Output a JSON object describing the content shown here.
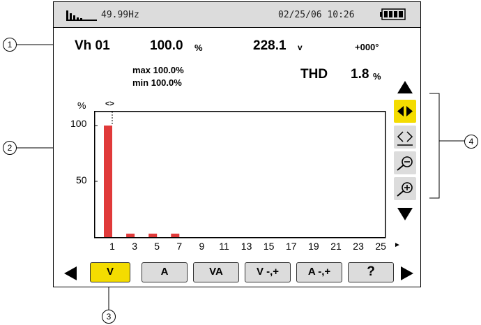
{
  "status": {
    "frequency": "49.99Hz",
    "datetime": "02/25/06 10:26"
  },
  "measure": {
    "harmonic_label": "Vh 01",
    "percent_value": "100.0",
    "percent_unit": "%",
    "volt_value": "228.1",
    "volt_unit": "v",
    "phase": "+000°",
    "max": "max 100.0%",
    "min": "min  100.0%",
    "thd_label": "THD",
    "thd_value": "1.8",
    "thd_unit": "%"
  },
  "chart_data": {
    "type": "bar",
    "ylabel": "%",
    "ytick_labels": [
      "100",
      "50"
    ],
    "cursor_marker": "<>",
    "categories": [
      "1",
      "2",
      "3",
      "4",
      "5",
      "6",
      "7",
      "8",
      "9",
      "10",
      "11",
      "12",
      "13",
      "14",
      "15",
      "16",
      "17",
      "18",
      "19",
      "20",
      "21",
      "22",
      "23",
      "24",
      "25"
    ],
    "values": [
      100,
      0,
      2,
      0,
      2,
      0,
      2,
      0,
      0,
      0,
      0,
      0,
      0,
      0,
      0,
      0,
      0,
      0,
      0,
      0,
      0,
      0,
      0,
      0,
      0
    ],
    "xtick_labels": [
      "1",
      "3",
      "5",
      "7",
      "9",
      "11",
      "13",
      "15",
      "17",
      "19",
      "21",
      "23",
      "25"
    ],
    "ylim": [
      0,
      110
    ],
    "bar_color": "#e03a3a",
    "more_right_marker": "►"
  },
  "softkeys": {
    "v": "V",
    "a": "A",
    "va": "VA",
    "v_pm": "V -,+",
    "a_pm": "A -,+",
    "help": "?"
  },
  "callouts": [
    "1",
    "2",
    "3",
    "4"
  ],
  "colors": {
    "active_key": "#f4dc00",
    "key": "#dcdcdc",
    "bar": "#e03a3a"
  }
}
